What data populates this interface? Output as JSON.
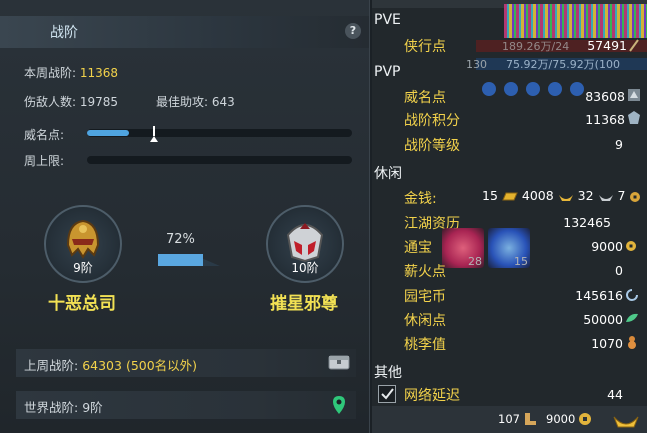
{
  "left_panel": {
    "title": "战阶",
    "help_symbol": "?",
    "weekly_rank_label": "本周战阶:",
    "weekly_rank_value": "11368",
    "kills_label": "伤敌人数:",
    "kills_value": "19785",
    "assists_label": "最佳助攻:",
    "assists_value": "643",
    "prestige_label": "威名点:",
    "prestige_progress": 0.16,
    "weekly_cap_label": "周上限:",
    "weekly_cap_progress": 0,
    "current_rank": {
      "level": "9阶",
      "name": "十恶总司"
    },
    "next_rank": {
      "level": "10阶",
      "name": "摧星邪尊"
    },
    "progress_percent": "72%",
    "progress_value": 0.72,
    "last_week_label": "上周战阶:",
    "last_week_value": "64303 (500名以外)",
    "world_rank_label": "世界战阶:",
    "world_rank_value": "9阶"
  },
  "right_panel": {
    "pve_title": "PVE",
    "pve_items": [
      {
        "label": "侠行点",
        "value": "57491"
      }
    ],
    "pvp_title": "PVP",
    "pvp_items": [
      {
        "label": "威名点",
        "value": "83608"
      },
      {
        "label": "战阶积分",
        "value": "11368"
      },
      {
        "label": "战阶等级",
        "value": "9"
      }
    ],
    "leisure_title": "休闲",
    "money": {
      "label": "金钱:",
      "gold_bar": "15",
      "gold_ingot": "4008",
      "silver": "32",
      "copper": "7"
    },
    "leisure_items": [
      {
        "label": "江湖资历",
        "value": "132465"
      },
      {
        "label": "通宝",
        "value": "9000"
      },
      {
        "label": "薪火点",
        "value": "0"
      },
      {
        "label": "园宅币",
        "value": "145616"
      },
      {
        "label": "休闲点",
        "value": "50000"
      },
      {
        "label": "桃李值",
        "value": "1070"
      }
    ],
    "other_title": "其他",
    "network_delay_label": "网络延迟",
    "network_delay_value": "44",
    "background_overlay": {
      "hp_text": "189.26万/24",
      "mp_text": "75.92万/75.92万(100",
      "level_badge": "130",
      "tile_count_1": "28",
      "tile_count_2": "15"
    },
    "bottom_bar": {
      "count": "107",
      "currency": "9000"
    }
  },
  "colors": {
    "gold_text": "#f2d24b",
    "rank_name": "#f2e154",
    "progress_blue": "#4fa4e0"
  }
}
